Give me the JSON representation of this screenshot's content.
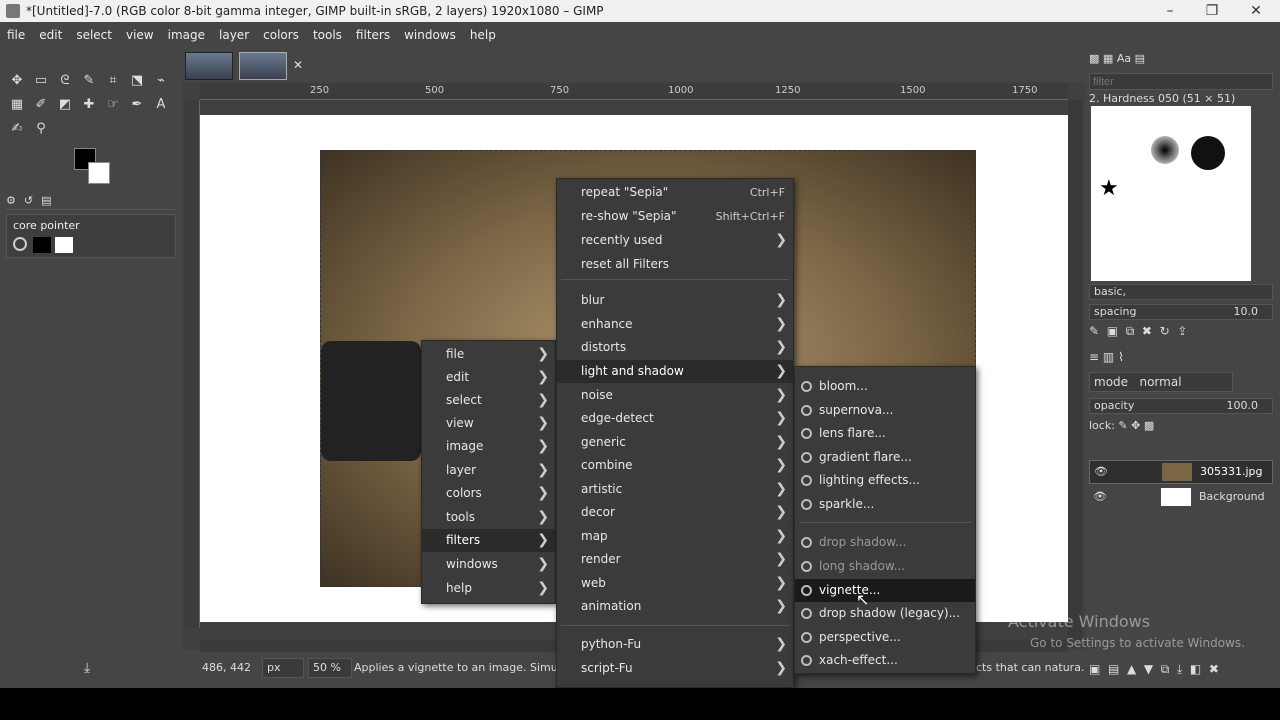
{
  "window": {
    "title": "*[Untitled]-7.0 (RGB color 8-bit gamma integer, GIMP built-in sRGB, 2 layers) 1920x1080 – GIMP",
    "min": "–",
    "max": "❐",
    "close": "✕"
  },
  "menubar": [
    "file",
    "edit",
    "select",
    "view",
    "image",
    "layer",
    "colors",
    "tools",
    "filters",
    "windows",
    "help"
  ],
  "toolbox": {
    "device_status_label": "core pointer",
    "tool_icons": [
      "move",
      "rect-select",
      "free-select",
      "fuzzy-select",
      "crop",
      "transform",
      "warp",
      "gradient",
      "paintbrush",
      "eraser",
      "heal",
      "smudge",
      "paths",
      "text",
      "color-picker",
      "zoom"
    ]
  },
  "ruler_ticks": [
    "250",
    "500",
    "750",
    "1000",
    "1250",
    "1500",
    "1750"
  ],
  "status": {
    "coords": "486, 442",
    "unit": "px",
    "zoom": "50 %",
    "message": "Applies a vignette to an image. Simulates",
    "message_right": "cts that can natura..."
  },
  "main_menu": [
    {
      "label": "file"
    },
    {
      "label": "edit"
    },
    {
      "label": "select"
    },
    {
      "label": "view"
    },
    {
      "label": "image"
    },
    {
      "label": "layer"
    },
    {
      "label": "colors"
    },
    {
      "label": "tools"
    },
    {
      "label": "filters",
      "highlight": true
    },
    {
      "label": "windows"
    },
    {
      "label": "help"
    }
  ],
  "filters_menu": {
    "repeat": {
      "label": "repeat \"Sepia\"",
      "accel": "Ctrl+F"
    },
    "reshow": {
      "label": "re-show \"Sepia\"",
      "accel": "Shift+Ctrl+F"
    },
    "recent": "recently used",
    "reset": "reset all Filters",
    "items": [
      "blur",
      "enhance",
      "distorts",
      "light and shadow",
      "noise",
      "edge-detect",
      "generic",
      "combine",
      "artistic",
      "decor",
      "map",
      "render",
      "web",
      "animation"
    ],
    "fu": [
      "python-Fu",
      "script-Fu"
    ]
  },
  "light_menu": {
    "group1": [
      "bloom...",
      "supernova...",
      "lens flare...",
      "gradient flare...",
      "lighting effects...",
      "sparkle..."
    ],
    "group2": [
      "drop shadow...",
      "long shadow...",
      "vignette...",
      "drop shadow (legacy)...",
      "perspective...",
      "xach-effect..."
    ]
  },
  "brushes": {
    "filter_placeholder": "filter",
    "current": "2. Hardness 050 (51 × 51)",
    "preset": "basic,",
    "spacing_label": "spacing",
    "spacing_value": "10.0"
  },
  "layers": {
    "mode_label": "mode",
    "mode_value": "normal",
    "opacity_label": "opacity",
    "opacity_value": "100.0",
    "lock_label": "lock:",
    "items": [
      "305331.jpg",
      "Background"
    ]
  },
  "watermark": {
    "line1": "Activate Windows",
    "line2": "Go to Settings to activate Windows."
  }
}
